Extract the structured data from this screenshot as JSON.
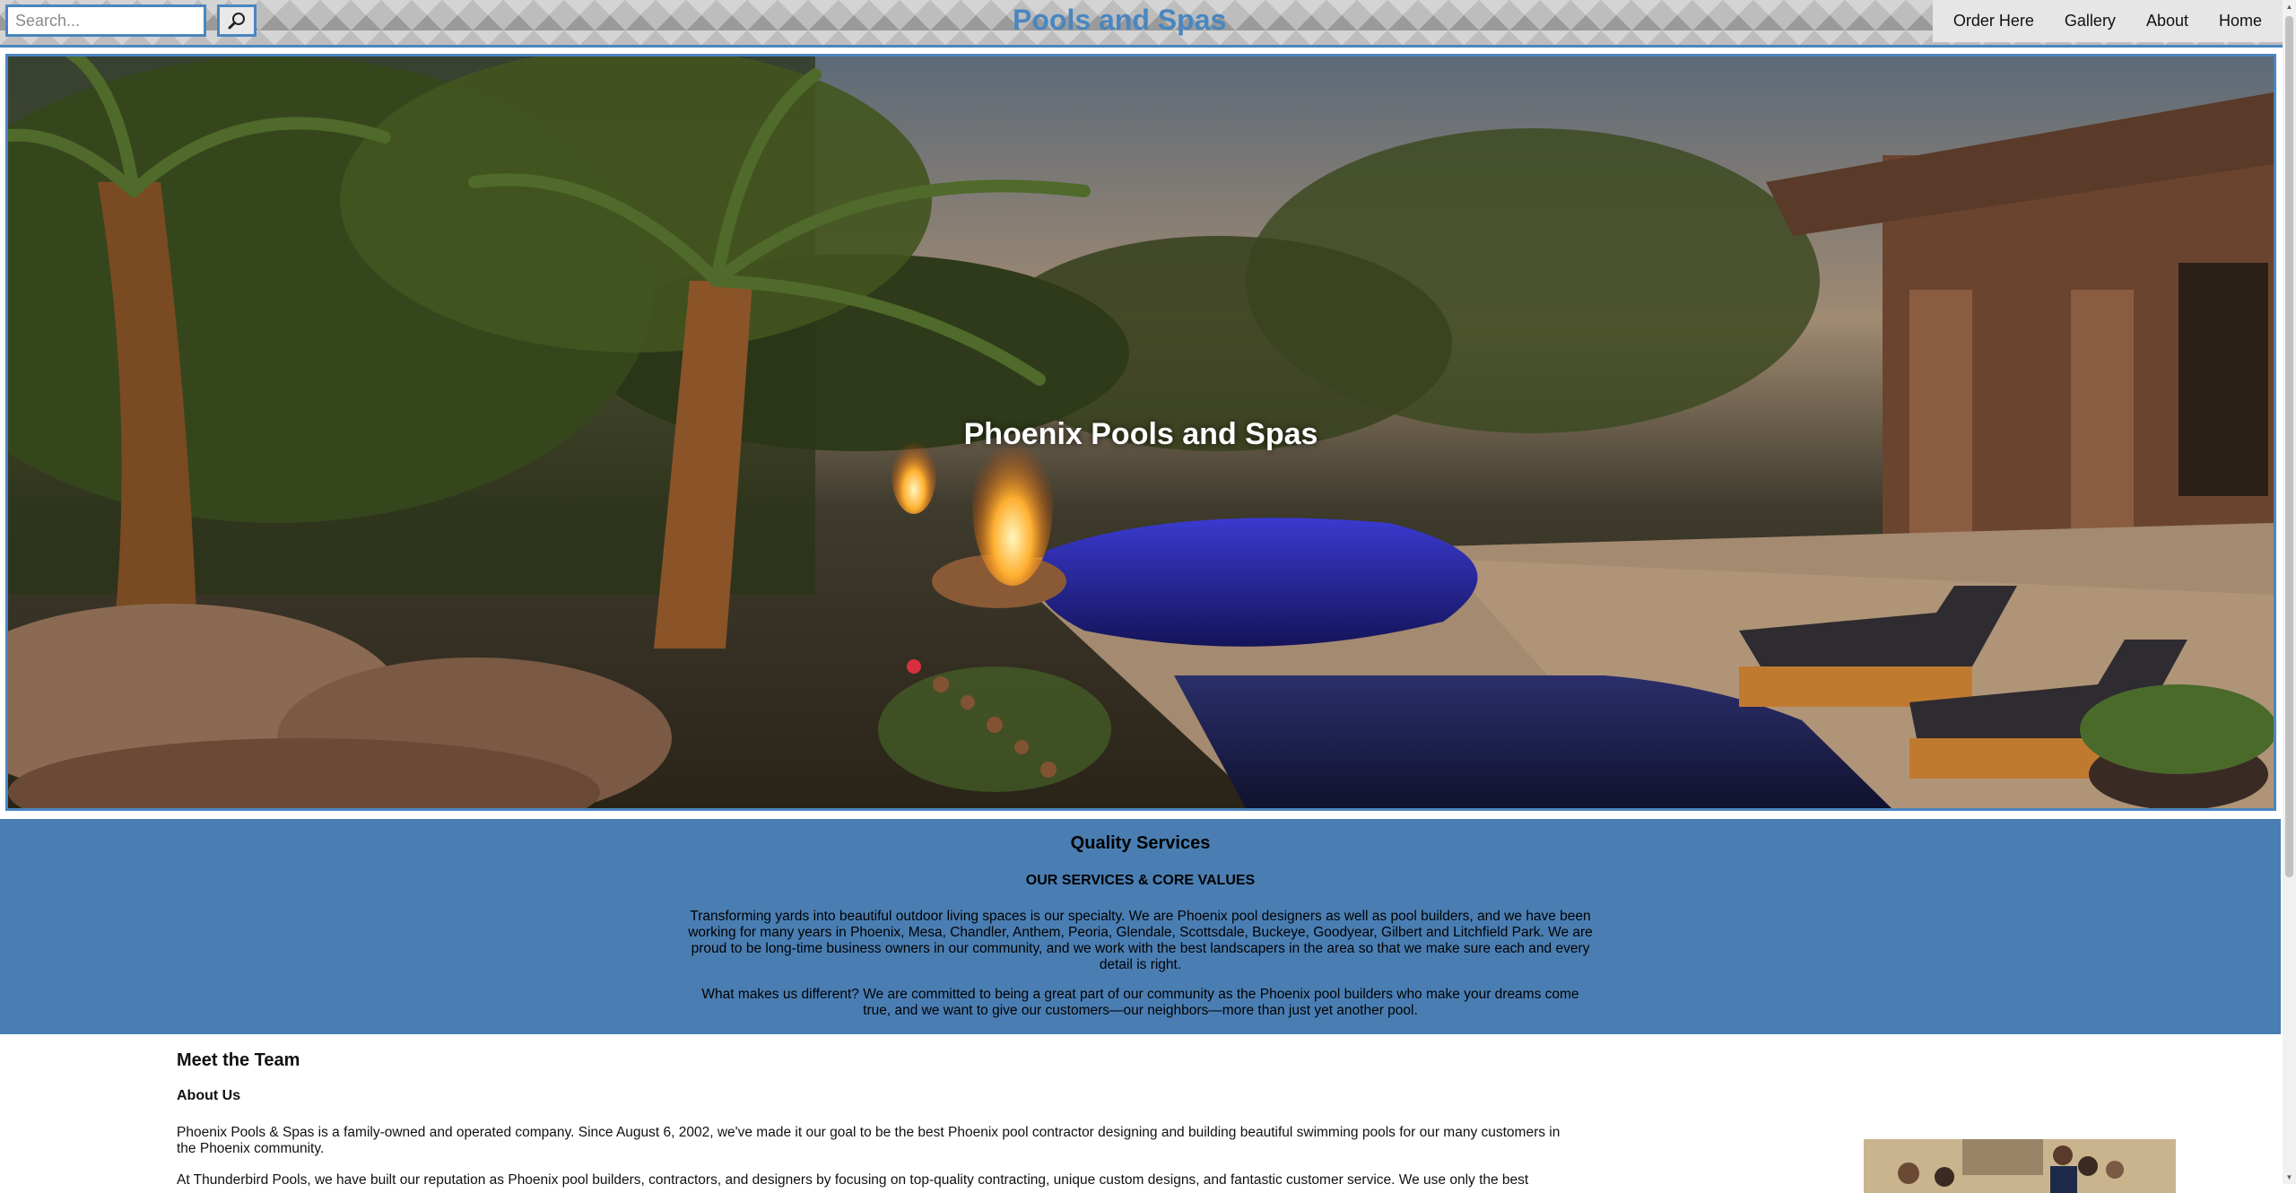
{
  "search": {
    "placeholder": "Search..."
  },
  "brand": {
    "title": "Pools and Spas"
  },
  "nav": {
    "items": [
      {
        "label": "Order Here"
      },
      {
        "label": "Gallery"
      },
      {
        "label": "About"
      },
      {
        "label": "Home"
      }
    ]
  },
  "hero": {
    "title": "Phoenix Pools and Spas"
  },
  "services": {
    "heading": "Quality Services",
    "subheading": "OUR SERVICES & CORE VALUES",
    "paragraph1": "Transforming yards into beautiful outdoor living spaces is our specialty. We are Phoenix pool designers as well as pool builders, and we have been working for many years in Phoenix, Mesa, Chandler, Anthem, Peoria, Glendale, Scottsdale, Buckeye, Goodyear, Gilbert and Litchfield Park. We are proud to be long-time business owners in our community, and we work with the best landscapers in the area so that we make sure each and every detail is right.",
    "paragraph2": "What makes us different? We are committed to being a great part of our community as the Phoenix pool builders who make your dreams come true, and we want to give our customers—our neighbors—more than just yet another pool."
  },
  "team": {
    "heading": "Meet the Team",
    "subheading": "About Us",
    "paragraph1": "Phoenix Pools & Spas is a family-owned and operated company. Since August 6, 2002, we've made it our goal to be the best Phoenix pool contractor designing and building beautiful swimming pools for our many customers in the Phoenix community.",
    "paragraph2": "At Thunderbird Pools, we have built our reputation as Phoenix pool builders, contractors, and designers by focusing on top-quality contracting, unique custom designs, and fantastic customer service. We use only the best"
  },
  "colors": {
    "accent": "#4a86c0",
    "services_band": "#4a7eb3",
    "nav_bg": "#e6e6e6"
  },
  "icons": {
    "search_button": "magnifier-icon"
  }
}
